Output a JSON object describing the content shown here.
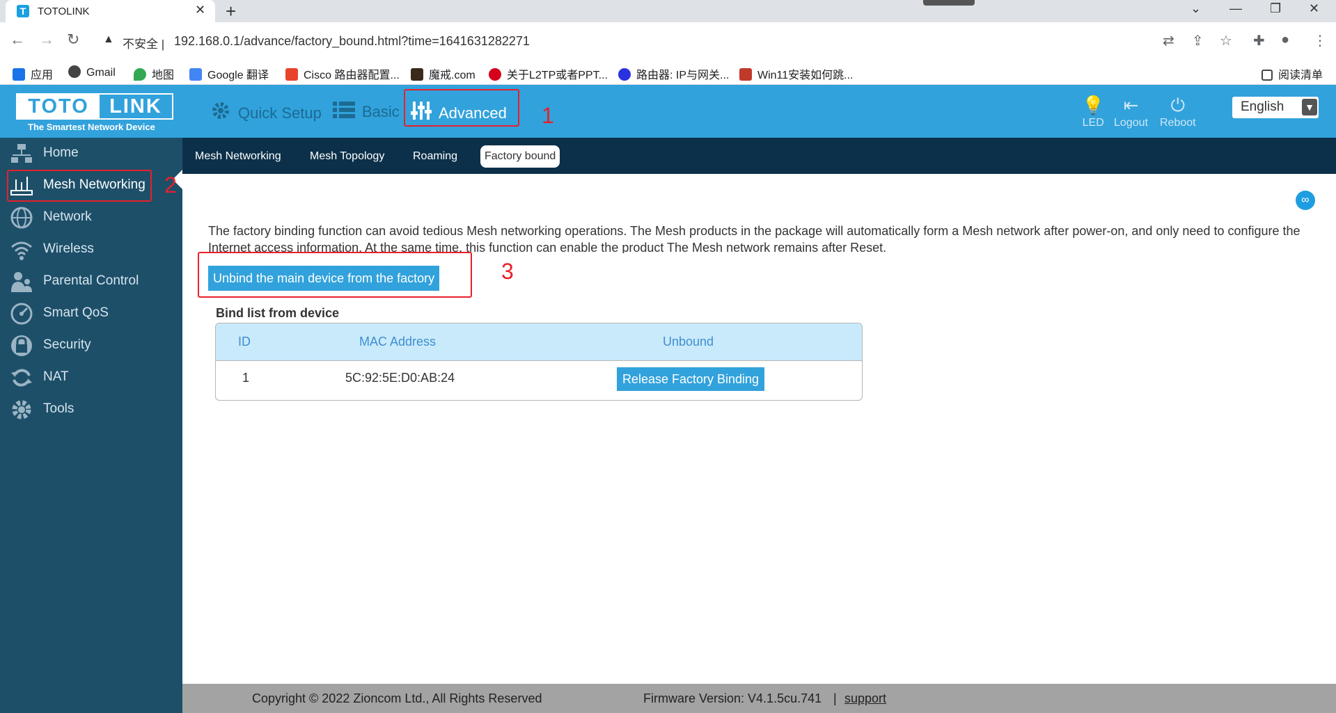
{
  "browser": {
    "tab_title": "TOTOLINK",
    "tab_favicon": "T",
    "close_glyph": "✕",
    "new_tab_glyph": "+",
    "window": {
      "chevron": "⌄",
      "minimize": "—",
      "restore": "❐",
      "close": "✕"
    },
    "insecure_label": "不安全 |",
    "url": "192.168.0.1/advance/factory_bound.html?time=1641631282271",
    "bookmarks": [
      {
        "label": "应用",
        "icon": "apps-grid-icon",
        "color": "#1a73e8"
      },
      {
        "label": "Gmail",
        "icon": "globe-icon",
        "color": "#444444"
      },
      {
        "label": "地图",
        "icon": "maps-pin-icon",
        "color": "#34a853"
      },
      {
        "label": "Google 翻译",
        "icon": "translate-icon",
        "color": "#4285f4"
      },
      {
        "label": "Cisco 路由器配置...",
        "icon": "bookmark-jian-icon",
        "color": "#e8442b"
      },
      {
        "label": "魔戒.com",
        "icon": "ring-icon",
        "color": "#3a2a1a"
      },
      {
        "label": "关于L2TP或者PPT...",
        "icon": "huawei-icon",
        "color": "#d6001c"
      },
      {
        "label": "路由器: IP与网关...",
        "icon": "baidu-paw-icon",
        "color": "#2932e1"
      },
      {
        "label": "Win11安装如何跳...",
        "icon": "site-b-icon",
        "color": "#c0392b"
      }
    ],
    "reading_list": "阅读清单"
  },
  "brand": {
    "logo_left": "TOTO",
    "logo_right": "LINK",
    "tagline": "The Smartest Network Device",
    "accent": "#31a2dc",
    "sidebar_bg": "#1d4f69",
    "subnav_bg": "#0c3049"
  },
  "top_nav": {
    "quick_setup": "Quick Setup",
    "basic": "Basic",
    "advanced": "Advanced"
  },
  "top_tools": {
    "led": "LED",
    "logout": "Logout",
    "reboot": "Reboot",
    "language": "English"
  },
  "annotations": {
    "one": "1",
    "two": "2",
    "three": "3",
    "color": "#e8202b"
  },
  "sidebar": {
    "items": [
      {
        "label": "Home",
        "icon": "home-network-icon"
      },
      {
        "label": "Mesh Networking",
        "icon": "mesh-router-icon"
      },
      {
        "label": "Network",
        "icon": "globe-icon"
      },
      {
        "label": "Wireless",
        "icon": "wifi-icon"
      },
      {
        "label": "Parental Control",
        "icon": "parental-icon"
      },
      {
        "label": "Smart QoS",
        "icon": "gauge-icon"
      },
      {
        "label": "Security",
        "icon": "lock-icon"
      },
      {
        "label": "NAT",
        "icon": "refresh-icon"
      },
      {
        "label": "Tools",
        "icon": "gear-icon"
      }
    ],
    "active_index": 1
  },
  "subnav": {
    "tabs": [
      "Mesh Networking",
      "Mesh Topology",
      "Roaming",
      "Factory bound"
    ],
    "active_index": 3
  },
  "page": {
    "description": "The factory binding function can avoid tedious Mesh networking operations. The Mesh products in the package will automatically form a Mesh network after power-on, and only need to configure the Internet access information. At the same time, this function can enable the product The Mesh network remains after Reset.",
    "unbind_button": "Unbind the main device from the factory",
    "bind_list_title": "Bind list from device",
    "table": {
      "headers": [
        "ID",
        "MAC Address",
        "Unbound"
      ],
      "rows": [
        {
          "id": "1",
          "mac": "5C:92:5E:D0:AB:24",
          "action": "Release Factory Binding"
        }
      ]
    }
  },
  "footer": {
    "copyright": "Copyright © 2022 Zioncom Ltd., All Rights Reserved",
    "firmware": "Firmware Version: V4.1.5cu.741",
    "separator": "|",
    "support": "support"
  }
}
